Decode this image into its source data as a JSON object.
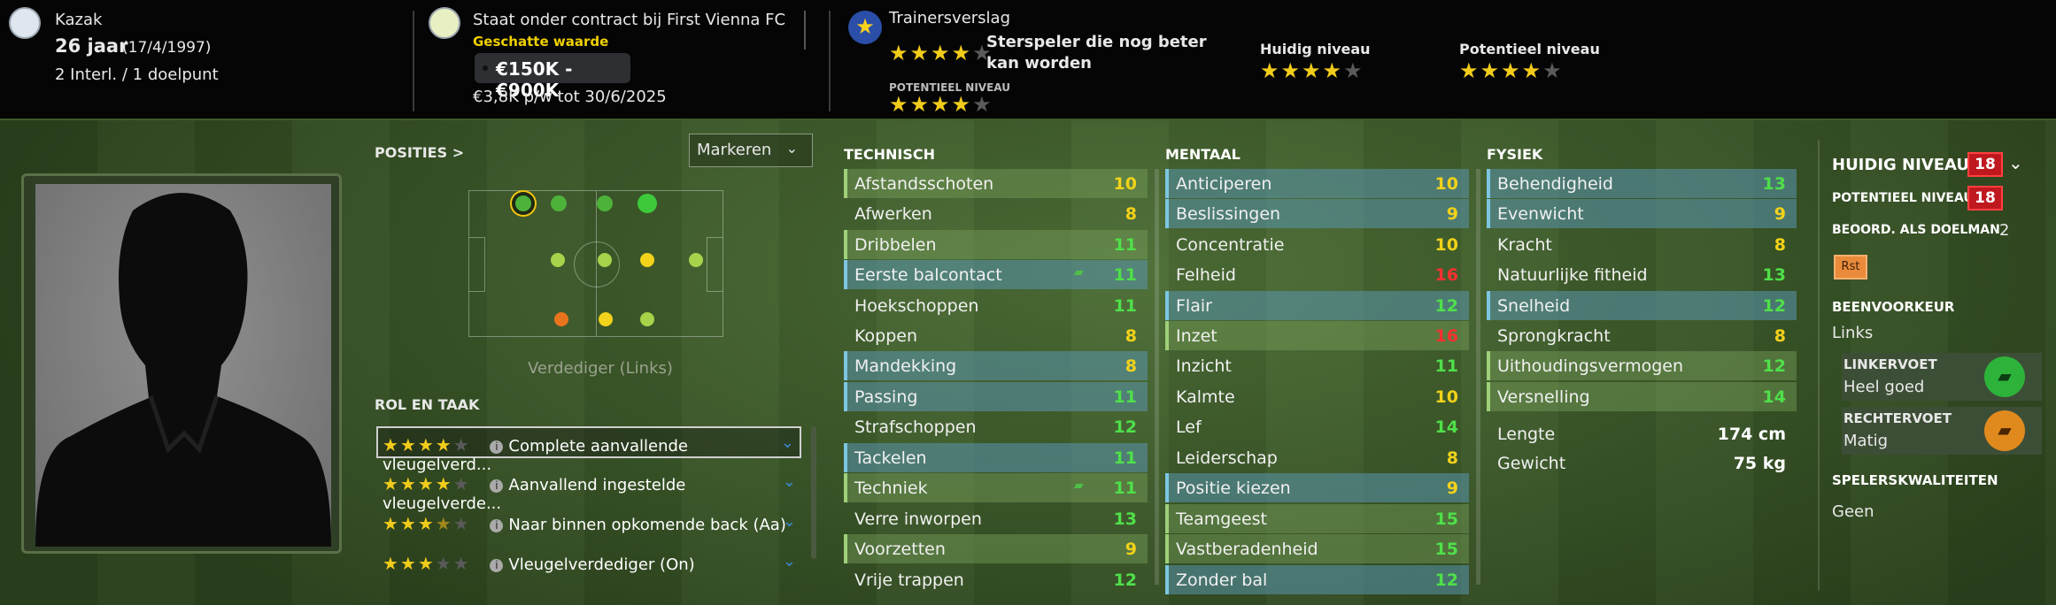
{
  "header": {
    "nationality": "Kazak",
    "age": "26 jaar",
    "dob": "(17/4/1997)",
    "caps": "2 Interl. / 1 doelpunt",
    "contract": "Staat onder contract bij First Vienna FC",
    "value_label": "Geschatte waarde",
    "value": "€150K - €900K",
    "wage": "€3,8K p/w tot 30/6/2025",
    "report_title": "Trainersverslag",
    "report_summary": "Sterspeler die nog beter kan worden",
    "potential_small": "POTENTIEEL NIVEAU",
    "current_label": "Huidig niveau",
    "potential_label": "Potentieel niveau",
    "star_ratings": {
      "report_current": 4,
      "report_potential": 4,
      "current": 4,
      "potential": 4
    }
  },
  "positions": {
    "title": "POSITIES >",
    "dropdown": "Markeren",
    "caption": "Verdediger (Links)"
  },
  "roles": {
    "title": "ROL EN TAAK",
    "items": [
      {
        "stars": 4,
        "label": "Complete aanvallende vleugelverd..."
      },
      {
        "stars": 4,
        "label": "Aanvallend ingestelde vleugelverde..."
      },
      {
        "stars": 3.5,
        "label": "Naar binnen opkomende back (Aa)"
      },
      {
        "stars": 3,
        "label": "Vleugelverdediger (On)"
      }
    ]
  },
  "technisch": {
    "title": "TECHNISCH",
    "items": [
      {
        "name": "Afstandsschoten",
        "value": "10"
      },
      {
        "name": "Afwerken",
        "value": "8"
      },
      {
        "name": "Dribbelen",
        "value": "11"
      },
      {
        "name": "Eerste balcontact",
        "value": "11"
      },
      {
        "name": "Hoekschoppen",
        "value": "11"
      },
      {
        "name": "Koppen",
        "value": "8"
      },
      {
        "name": "Mandekking",
        "value": "8"
      },
      {
        "name": "Passing",
        "value": "11"
      },
      {
        "name": "Strafschoppen",
        "value": "12"
      },
      {
        "name": "Tackelen",
        "value": "11"
      },
      {
        "name": "Techniek",
        "value": "11"
      },
      {
        "name": "Verre inworpen",
        "value": "13"
      },
      {
        "name": "Voorzetten",
        "value": "9"
      },
      {
        "name": "Vrije trappen",
        "value": "12"
      }
    ]
  },
  "mentaal": {
    "title": "MENTAAL",
    "items": [
      {
        "name": "Anticiperen",
        "value": "10"
      },
      {
        "name": "Beslissingen",
        "value": "9"
      },
      {
        "name": "Concentratie",
        "value": "10"
      },
      {
        "name": "Felheid",
        "value": "16"
      },
      {
        "name": "Flair",
        "value": "12"
      },
      {
        "name": "Inzet",
        "value": "16"
      },
      {
        "name": "Inzicht",
        "value": "11"
      },
      {
        "name": "Kalmte",
        "value": "10"
      },
      {
        "name": "Lef",
        "value": "14"
      },
      {
        "name": "Leiderschap",
        "value": "8"
      },
      {
        "name": "Positie kiezen",
        "value": "9"
      },
      {
        "name": "Teamgeest",
        "value": "15"
      },
      {
        "name": "Vastberadenheid",
        "value": "15"
      },
      {
        "name": "Zonder bal",
        "value": "12"
      }
    ]
  },
  "fysiek": {
    "title": "FYSIEK",
    "items": [
      {
        "name": "Behendigheid",
        "value": "13"
      },
      {
        "name": "Evenwicht",
        "value": "9"
      },
      {
        "name": "Kracht",
        "value": "8"
      },
      {
        "name": "Natuurlijke fitheid",
        "value": "13"
      },
      {
        "name": "Snelheid",
        "value": "12"
      },
      {
        "name": "Sprongkracht",
        "value": "8"
      },
      {
        "name": "Uithoudingsvermogen",
        "value": "12"
      },
      {
        "name": "Versnelling",
        "value": "14"
      }
    ],
    "height_label": "Lengte",
    "height": "174 cm",
    "weight_label": "Gewicht",
    "weight": "75 kg"
  },
  "right_panel": {
    "current_level": "HUIDIG NIVEAU",
    "current_value": "18",
    "potential_level": "POTENTIEEL NIVEAU",
    "potential_value": "18",
    "gk_rating_label": "BEOORD. ALS DOELMAN",
    "gk_rating": "2",
    "rst_badge": "Rst",
    "foot_title": "BEENVOORKEUR",
    "foot_pref": "Links",
    "left_foot_label": "LINKERVOET",
    "left_foot_value": "Heel goed",
    "right_foot_label": "RECHTERVOET",
    "right_foot_value": "Matig",
    "traits_title": "SPELERSKWALITEITEN",
    "traits_value": "Geen"
  },
  "colors": {
    "green": "#4fe04a",
    "yellow": "#f2d21a",
    "red": "#ff3030",
    "highlight_blue": "#5a96af",
    "star": "#f2cc1b"
  }
}
